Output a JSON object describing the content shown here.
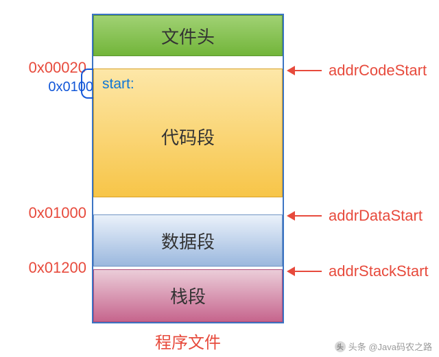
{
  "segments": {
    "header": {
      "label": "文件头"
    },
    "code": {
      "label": "代码段",
      "start_symbol": "start:"
    },
    "data": {
      "label": "数据段"
    },
    "stack": {
      "label": "栈段"
    }
  },
  "addresses": {
    "code_start": "0x00020",
    "entry_offset": "0x0100",
    "data_start": "0x01000",
    "stack_start": "0x01200"
  },
  "pointers": {
    "code": "addrCodeStart",
    "data": "addrDataStart",
    "stack": "addrStackStart"
  },
  "caption": "程序文件",
  "watermark": "头条 @Java码农之路"
}
